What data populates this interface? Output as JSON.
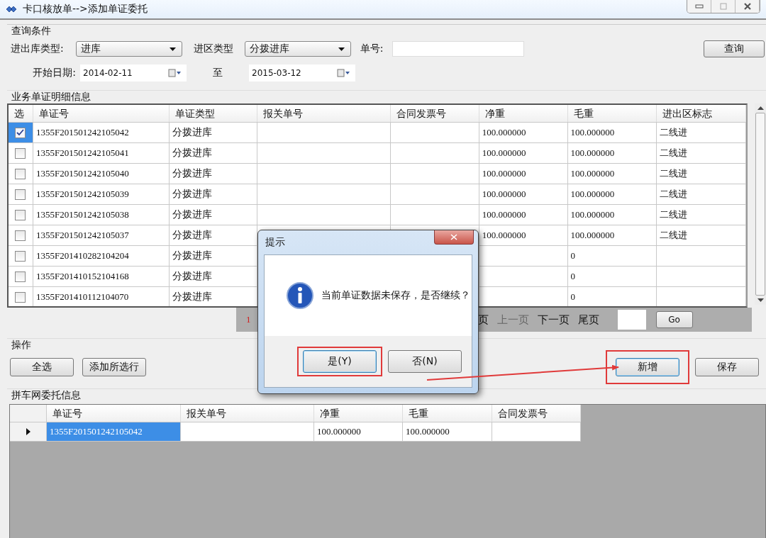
{
  "window": {
    "title": "卡口核放单-->添加单证委托"
  },
  "query": {
    "legend": "查询条件",
    "io_type": {
      "label": "进出库类型:",
      "value": "进库"
    },
    "zone_type": {
      "label": "进区类型",
      "value": "分拨进库"
    },
    "doc_no": {
      "label": "单号:"
    },
    "search_button": "查询",
    "start_date": {
      "label": "开始日期:",
      "value": "2014-02-11"
    },
    "to_label": "至",
    "end_date": {
      "value": "2015-03-12"
    }
  },
  "detail": {
    "title": "业务单证明细信息",
    "columns": [
      "选",
      "单证号",
      "单证类型",
      "报关单号",
      "合同发票号",
      "净重",
      "毛重",
      "进出区标志"
    ],
    "rows": [
      {
        "selected": true,
        "checked": true,
        "doc_no": "1355F201501242105042",
        "doc_type": "分拨进库",
        "net": "100.000000",
        "gross": "100.000000",
        "flag": "二线进"
      },
      {
        "selected": false,
        "checked": false,
        "doc_no": "1355F201501242105041",
        "doc_type": "分拨进库",
        "net": "100.000000",
        "gross": "100.000000",
        "flag": "二线进"
      },
      {
        "selected": false,
        "checked": false,
        "doc_no": "1355F201501242105040",
        "doc_type": "分拨进库",
        "net": "100.000000",
        "gross": "100.000000",
        "flag": "二线进"
      },
      {
        "selected": false,
        "checked": false,
        "doc_no": "1355F201501242105039",
        "doc_type": "分拨进库",
        "net": "100.000000",
        "gross": "100.000000",
        "flag": "二线进"
      },
      {
        "selected": false,
        "checked": false,
        "doc_no": "1355F201501242105038",
        "doc_type": "分拨进库",
        "net": "100.000000",
        "gross": "100.000000",
        "flag": "二线进"
      },
      {
        "selected": false,
        "checked": false,
        "doc_no": "1355F201501242105037",
        "doc_type": "分拨进库",
        "net": "100.000000",
        "gross": "100.000000",
        "flag": "二线进"
      },
      {
        "selected": false,
        "checked": false,
        "doc_no": "1355F201410282104204",
        "doc_type": "分拨进库",
        "gross": "0"
      },
      {
        "selected": false,
        "checked": false,
        "doc_no": "1355F201410152104168",
        "doc_type": "分拨进库",
        "gross": "0"
      },
      {
        "selected": false,
        "checked": false,
        "doc_no": "1355F201410112104070",
        "doc_type": "分拨进库",
        "gross": "0"
      }
    ]
  },
  "pager": {
    "items": [
      {
        "text": "1",
        "kind": "current"
      },
      {
        "text": "页",
        "kind": "link"
      },
      {
        "text": "上一页",
        "kind": "disabled"
      },
      {
        "text": "下一页",
        "kind": "link"
      },
      {
        "text": "尾页",
        "kind": "link"
      }
    ],
    "go_button": "Go"
  },
  "actions": {
    "title": "操作",
    "left_buttons": [
      {
        "label": "全选",
        "highlighted": false
      },
      {
        "label": "添加所选行",
        "highlighted": false
      }
    ],
    "right_buttons": [
      {
        "label": "新增",
        "highlighted": true
      },
      {
        "label": "保存",
        "highlighted": false
      }
    ]
  },
  "carpool": {
    "title": "拼车网委托信息",
    "columns": [
      "单证号",
      "报关单号",
      "净重",
      "毛重",
      "合同发票号"
    ],
    "rows": [
      {
        "selected": true,
        "doc_no": "1355F201501242105042",
        "net": "100.000000",
        "gross": "100.000000"
      }
    ]
  },
  "dialog": {
    "title": "提示",
    "message": "当前单证数据未保存，是否继续？",
    "buttons": [
      {
        "label": "是(Y)",
        "highlighted": true
      },
      {
        "label": "否(N)",
        "highlighted": false
      }
    ]
  }
}
